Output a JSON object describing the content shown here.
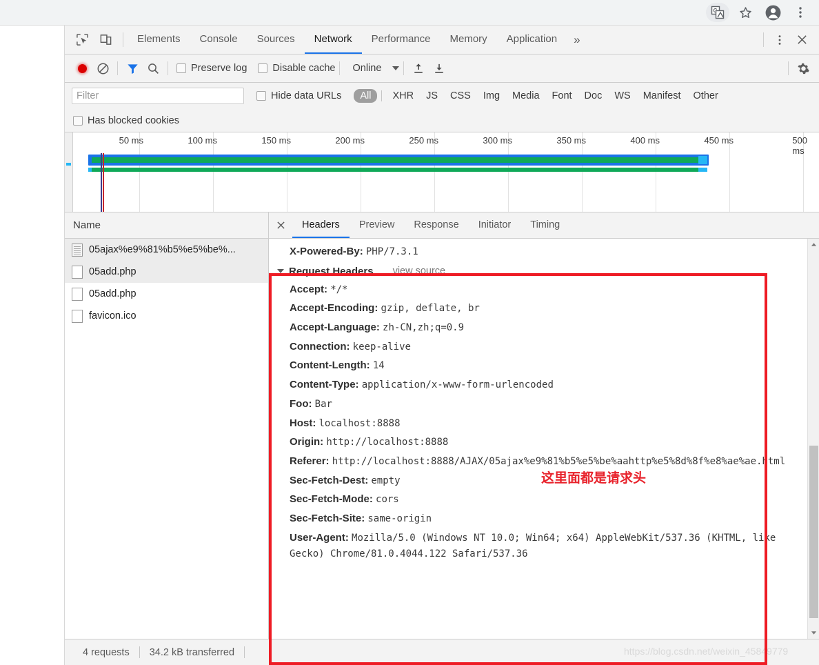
{
  "browser": {
    "icons": [
      {
        "name": "translate-icon",
        "glyph": "G"
      },
      {
        "name": "bookmark-star-icon",
        "glyph": "☆"
      },
      {
        "name": "profile-avatar-icon",
        "glyph": "●"
      },
      {
        "name": "chrome-menu-icon",
        "glyph": "⋮"
      }
    ]
  },
  "devtools": {
    "tools": [
      {
        "name": "inspect-element-icon",
        "label": "Inspect element"
      },
      {
        "name": "device-toolbar-icon",
        "label": "Toggle device toolbar"
      }
    ],
    "tabs": [
      {
        "label": "Elements",
        "active": false
      },
      {
        "label": "Console",
        "active": false
      },
      {
        "label": "Sources",
        "active": false
      },
      {
        "label": "Network",
        "active": true
      },
      {
        "label": "Performance",
        "active": false
      },
      {
        "label": "Memory",
        "active": false
      },
      {
        "label": "Application",
        "active": false
      }
    ],
    "more_tabs_glyph": "»",
    "settings_glyph": "⋮",
    "close_glyph": "✕"
  },
  "network_toolbar": {
    "record_label": "Record",
    "clear_label": "Clear",
    "filter_label": "Filter",
    "search_label": "Search",
    "preserve_log": "Preserve log",
    "disable_cache": "Disable cache",
    "throttling": "Online",
    "import_label": "Import HAR",
    "export_label": "Export HAR",
    "settings_label": "Settings"
  },
  "filter_bar": {
    "input_placeholder": "Filter",
    "input_value": "",
    "hide_data_urls": "Hide data URLs",
    "has_blocked_cookies": "Has blocked cookies",
    "types": [
      {
        "label": "All",
        "active": true
      },
      {
        "label": "XHR",
        "active": false
      },
      {
        "label": "JS",
        "active": false
      },
      {
        "label": "CSS",
        "active": false
      },
      {
        "label": "Img",
        "active": false
      },
      {
        "label": "Media",
        "active": false
      },
      {
        "label": "Font",
        "active": false
      },
      {
        "label": "Doc",
        "active": false
      },
      {
        "label": "WS",
        "active": false
      },
      {
        "label": "Manifest",
        "active": false
      },
      {
        "label": "Other",
        "active": false
      }
    ]
  },
  "overview": {
    "ticks": [
      "50 ms",
      "100 ms",
      "150 ms",
      "200 ms",
      "250 ms",
      "300 ms",
      "350 ms",
      "400 ms",
      "450 ms",
      "500 ms"
    ],
    "colors": {
      "green": "#0fa958",
      "blue": "#1a73e8",
      "light_blue": "#25b7f5",
      "marker_red": "#c4262e",
      "marker_blue": "#3b3f8f"
    }
  },
  "requests": {
    "column_header": "Name",
    "rows": [
      {
        "name": "05ajax%e9%81%b5%e5%be%...",
        "icon": "document-icon"
      },
      {
        "name": "05add.php",
        "icon": "file-icon"
      },
      {
        "name": "05add.php",
        "icon": "file-icon"
      },
      {
        "name": "favicon.ico",
        "icon": "file-icon"
      }
    ]
  },
  "detail": {
    "tabs": [
      {
        "label": "Headers",
        "active": true
      },
      {
        "label": "Preview",
        "active": false
      },
      {
        "label": "Response",
        "active": false
      },
      {
        "label": "Initiator",
        "active": false
      },
      {
        "label": "Timing",
        "active": false
      }
    ],
    "top_header": {
      "key": "X-Powered-By:",
      "value": "PHP/7.3.1"
    },
    "section_title": "Request Headers",
    "view_source": "view source",
    "headers": [
      {
        "key": "Accept:",
        "value": "*/*"
      },
      {
        "key": "Accept-Encoding:",
        "value": "gzip, deflate, br"
      },
      {
        "key": "Accept-Language:",
        "value": "zh-CN,zh;q=0.9"
      },
      {
        "key": "Connection:",
        "value": "keep-alive"
      },
      {
        "key": "Content-Length:",
        "value": "14"
      },
      {
        "key": "Content-Type:",
        "value": "application/x-www-form-urlencoded"
      },
      {
        "key": "Foo:",
        "value": "Bar"
      },
      {
        "key": "Host:",
        "value": "localhost:8888"
      },
      {
        "key": "Origin:",
        "value": "http://localhost:8888"
      }
    ],
    "referer": {
      "key": "Referer:",
      "value": "http://localhost:8888/AJAX/05ajax%e9%81%b5%e5%be%aahttp%e5%8d%8f%e8%ae%ae.html"
    },
    "headers_after": [
      {
        "key": "Sec-Fetch-Dest:",
        "value": "empty"
      },
      {
        "key": "Sec-Fetch-Mode:",
        "value": "cors"
      },
      {
        "key": "Sec-Fetch-Site:",
        "value": "same-origin"
      }
    ],
    "user_agent": {
      "key": "User-Agent:",
      "value": "Mozilla/5.0 (Windows NT 10.0; Win64; x64) AppleWebKit/537.36 (KHTML, like Gecko) Chrome/81.0.4044.122 Safari/537.36"
    }
  },
  "annotation": {
    "text": "这里面都是请求头",
    "color": "#ee1c25"
  },
  "watermark": {
    "text": "https://blog.csdn.net/weixin_45849779"
  },
  "statusbar": {
    "requests": "4 requests",
    "transferred": "34.2 kB transferred"
  }
}
